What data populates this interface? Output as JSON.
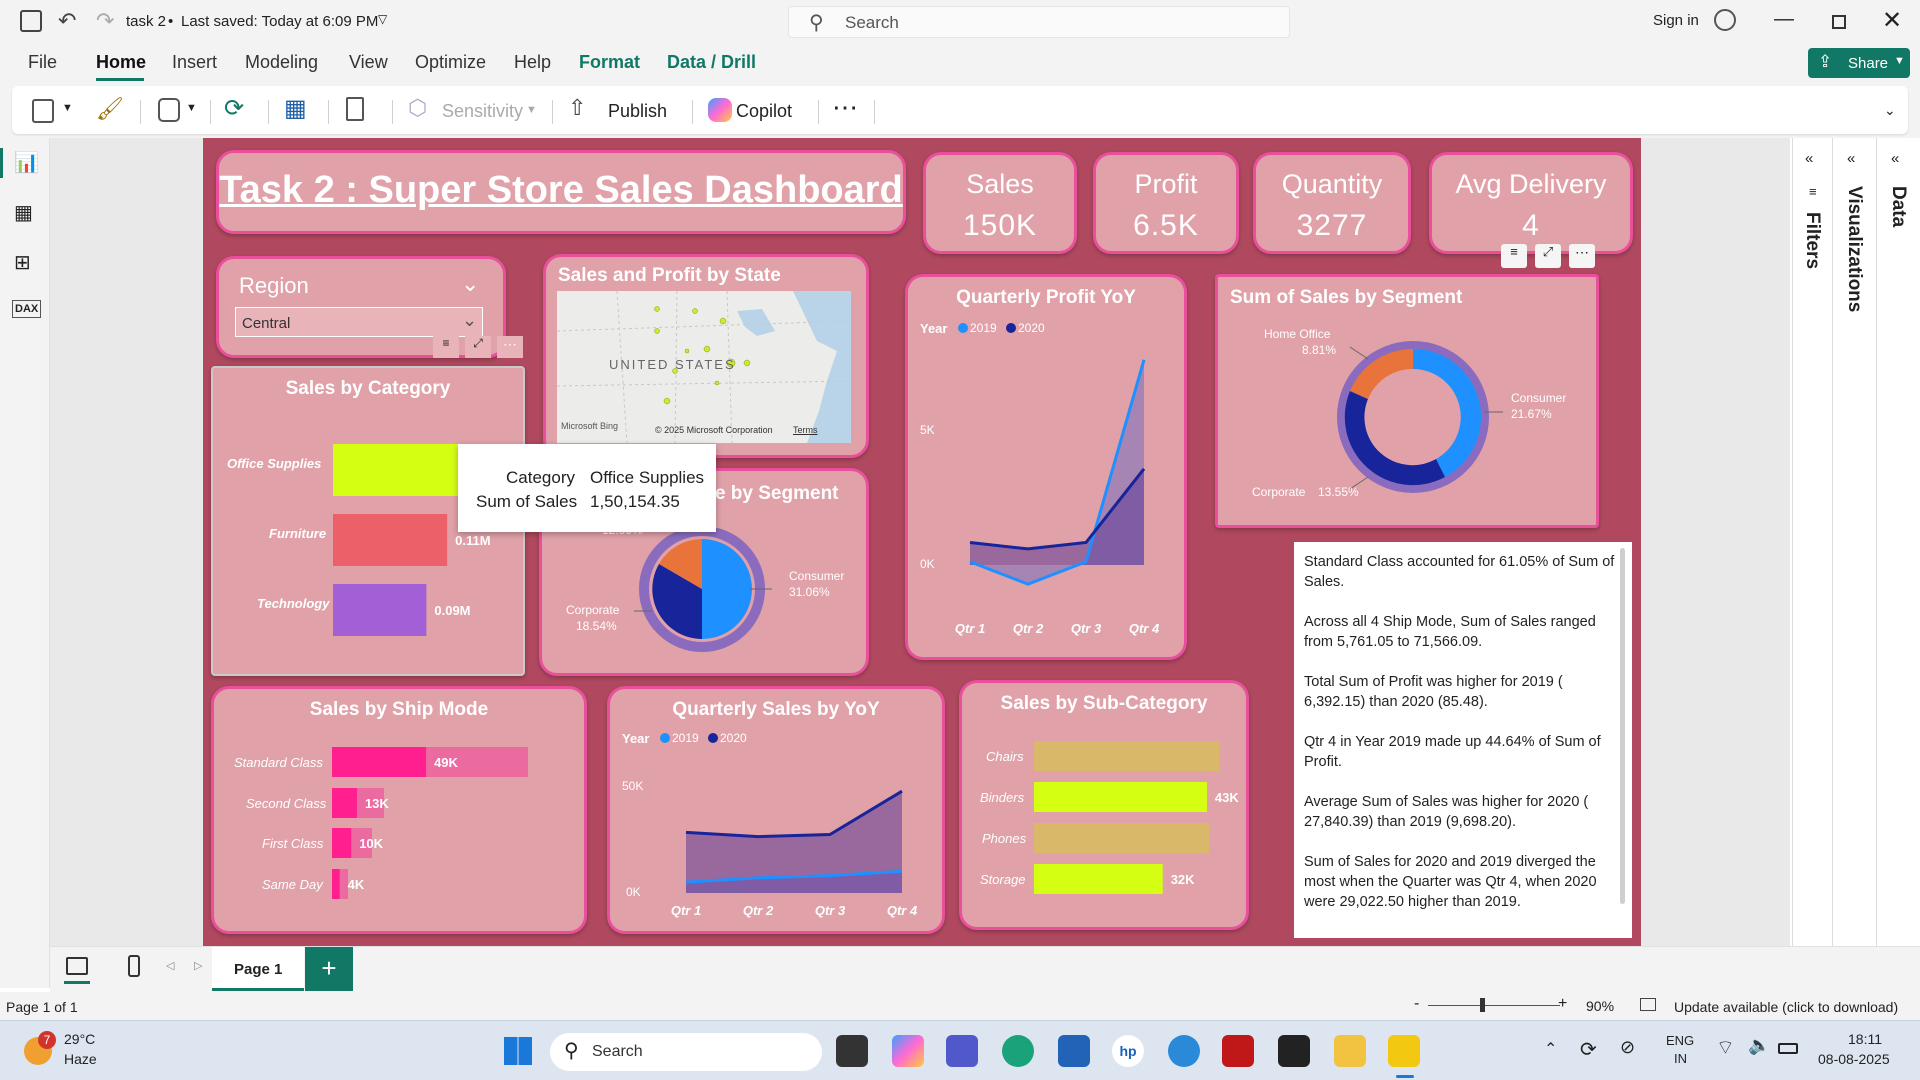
{
  "titlebar": {
    "doc_title": "task 2",
    "saved": "Last saved: Today at 6:09 PM",
    "search_placeholder": "Search",
    "sign_in": "Sign in"
  },
  "menu": [
    "File",
    "Home",
    "Insert",
    "Modeling",
    "View",
    "Optimize",
    "Help",
    "Format",
    "Data / Drill"
  ],
  "share_label": "Share",
  "ribbon": {
    "sensitivity": "Sensitivity",
    "publish": "Publish",
    "copilot": "Copilot"
  },
  "dashboard": {
    "title": "Task 2 : Super Store Sales Dashboard",
    "kpis": [
      {
        "label": "Sales",
        "value": "150K"
      },
      {
        "label": "Profit",
        "value": "6.5K"
      },
      {
        "label": "Quantity",
        "value": "3277"
      },
      {
        "label": "Avg Delivery",
        "value": "4"
      }
    ],
    "region": {
      "label": "Region",
      "selected": "Central"
    },
    "map": {
      "title": "Sales and Profit by State",
      "country": "UNITED STATES",
      "bing": "Microsoft Bing",
      "copyright": "© 2025 Microsoft Corporation",
      "terms": "Terms"
    },
    "tooltip": {
      "k1": "Category",
      "v1": "Office Supplies",
      "k2": "Sum of Sales",
      "v2": "1,50,154.35"
    },
    "ship_segment": {
      "title": "Ship Mode by Segment",
      "consumer": "Consumer",
      "consumer_pct": "31.06%",
      "corporate": "Corporate",
      "corporate_pct": "18.54%",
      "top_pct": "12.09%"
    },
    "qp": {
      "title": "Quarterly Profit YoY",
      "legend_title": "Year",
      "ytick_hi": "5K",
      "ytick_lo": "0K"
    },
    "qs": {
      "title": "Quarterly Sales by YoY",
      "legend_title": "Year",
      "ytick_hi": "50K",
      "ytick_lo": "0K"
    },
    "segment": {
      "title": "Sum of Sales by Segment",
      "home": "Home Office",
      "home_pct": "8.81%",
      "consumer": "Consumer",
      "consumer_pct": "21.67%",
      "corporate": "Corporate",
      "corporate_pct": "13.55%"
    },
    "category_title": "Sales by Category",
    "shipmode_title": "Sales by Ship Mode",
    "subcat_title": "Sales by Sub-Category",
    "narrative": [
      "Standard Class accounted for 61.05% of Sum of Sales.",
      "Across all 4 Ship Mode, Sum of Sales ranged from 5,761.05 to 71,566.09.",
      "Total Sum of Profit was higher for 2019 ( 6,392.15) than 2020 (85.48).",
      "Qtr 4 in Year 2019 made up 44.64% of Sum of Profit.",
      "Average Sum of Sales was higher for 2020 ( 27,840.39) than 2019 (9,698.20).",
      "Sum of Sales for 2020 and 2019 diverged the most when the Quarter was Qtr 4, when 2020 were 29,022.50 higher than 2019."
    ]
  },
  "chart_data": [
    {
      "type": "bar",
      "title": "Sales by Category",
      "categories": [
        "Office Supplies",
        "Furniture",
        "Technology"
      ],
      "values": [
        0.15,
        0.11,
        0.09
      ],
      "value_labels": [
        "0.15M",
        "0.11M",
        "0.09M"
      ],
      "colors": [
        "#d4ff12",
        "#ec6169",
        "#a35fd6"
      ]
    },
    {
      "type": "bar",
      "title": "Sales by Ship Mode",
      "categories": [
        "Standard Class",
        "Second Class",
        "First Class",
        "Same Day"
      ],
      "values": [
        49,
        13,
        10,
        4
      ],
      "value_labels": [
        "49K",
        "13K",
        "10K",
        "4K"
      ]
    },
    {
      "type": "bar",
      "title": "Sales by Sub-Category",
      "categories": [
        "Chairs",
        "Binders",
        "Phones",
        "Storage"
      ],
      "values": [
        null,
        43,
        null,
        32
      ],
      "value_labels": [
        "",
        "43K",
        "",
        "32K"
      ]
    },
    {
      "type": "area",
      "title": "Quarterly Profit YoY",
      "categories": [
        "Qtr 1",
        "Qtr 2",
        "Qtr 3",
        "Qtr 4"
      ],
      "series": [
        {
          "name": "2019",
          "values": [
            0.3,
            -0.4,
            0.3,
            6.6
          ]
        },
        {
          "name": "2020",
          "values": [
            0.9,
            0.7,
            0.9,
            3.2
          ]
        }
      ],
      "ylim": [
        -0.8,
        7
      ]
    },
    {
      "type": "area",
      "title": "Quarterly Sales by YoY",
      "categories": [
        "Qtr 1",
        "Qtr 2",
        "Qtr 3",
        "Qtr 4"
      ],
      "series": [
        {
          "name": "2019",
          "values": [
            5,
            7,
            8,
            10
          ]
        },
        {
          "name": "2020",
          "values": [
            28,
            26,
            27,
            47
          ]
        }
      ],
      "ylim": [
        0,
        60
      ]
    }
  ],
  "page_tab": "Page 1",
  "status": {
    "page": "Page 1 of 1",
    "zoom": "90%",
    "update": "Update available (click to download)"
  },
  "taskbar": {
    "temp": "29°C",
    "weather": "Haze",
    "badge": "7",
    "search": "Search",
    "lang1": "ENG",
    "lang2": "IN",
    "time": "18:11",
    "date": "08-08-2025"
  },
  "panes": {
    "filters": "Filters",
    "visualizations": "Visualizations",
    "data": "Data"
  }
}
